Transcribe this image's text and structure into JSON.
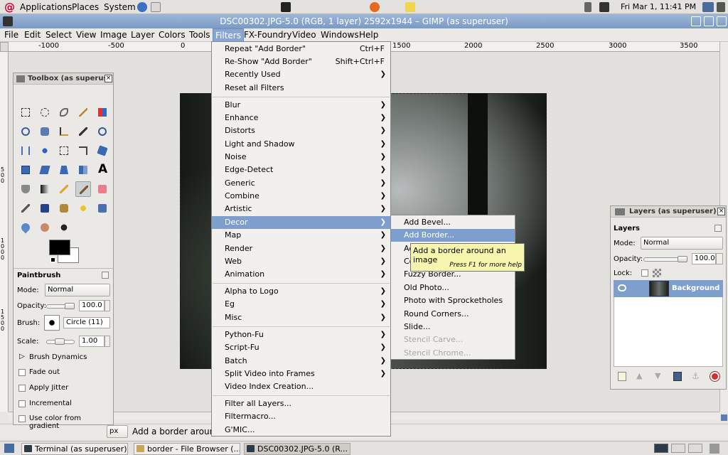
{
  "panel": {
    "menus": [
      "Applications",
      "Places",
      "System"
    ],
    "clock": "Fri Mar  1, 11:41 PM"
  },
  "window": {
    "title": "DSC00302.JPG-5.0 (RGB, 1 layer) 2592x1944 – GIMP (as superuser)"
  },
  "menubar": [
    "File",
    "Edit",
    "Select",
    "View",
    "Image",
    "Layer",
    "Colors",
    "Tools",
    "Filters",
    "FX-Foundry",
    "Video",
    "Windows",
    "Help"
  ],
  "ruler": [
    "-1000",
    "-500",
    "0",
    "1500",
    "2000",
    "2500",
    "3000",
    "3500"
  ],
  "ruler_left": [
    "5\n0\n0",
    "1\n0\n0\n0",
    "1\n5\n0\n0"
  ],
  "status": {
    "unit": "px",
    "text": "Add a border around a"
  },
  "taskbar": [
    "Terminal (as superuser)",
    "border - File Browser (...",
    "DSC00302.JPG-5.0 (R..."
  ],
  "toolbox": {
    "title": "Toolbox (as superus",
    "section": "Paintbrush",
    "mode_label": "Mode:",
    "mode_value": "Normal",
    "opacity_label": "Opacity:",
    "opacity_value": "100.0",
    "brush_label": "Brush:",
    "brush_value": "Circle (11)",
    "scale_label": "Scale:",
    "scale_value": "1.00",
    "dynamics": "Brush Dynamics",
    "options": [
      "Fade out",
      "Apply Jitter",
      "Incremental",
      "Use color from gradient"
    ]
  },
  "layers": {
    "title": "Layers (as superuser)",
    "heading": "Layers",
    "mode_label": "Mode:",
    "mode_value": "Normal",
    "opacity_label": "Opacity:",
    "opacity_value": "100.0",
    "lock_label": "Lock:",
    "layer_name": "Background"
  },
  "filters_menu": {
    "repeat": "Repeat \"Add Border\"",
    "repeat_acc": "Ctrl+F",
    "reshow": "Re-Show \"Add Border\"",
    "reshow_acc": "Shift+Ctrl+F",
    "recent": "Recently Used",
    "reset": "Reset all Filters",
    "group1": [
      "Blur",
      "Enhance",
      "Distorts",
      "Light and Shadow",
      "Noise",
      "Edge-Detect",
      "Generic",
      "Combine",
      "Artistic",
      "Decor",
      "Map",
      "Render",
      "Web",
      "Animation"
    ],
    "group2": [
      "Alpha to Logo",
      "Eg",
      "Misc"
    ],
    "group3": [
      "Python-Fu",
      "Script-Fu",
      "Batch",
      "Split Video into Frames",
      "Video Index Creation..."
    ],
    "group4": [
      "Filter all Layers...",
      "Filtermacro...",
      "G'MIC..."
    ]
  },
  "decor_menu": [
    "Add Bevel...",
    "Add Border...",
    "Ad",
    "Co",
    "Fuzzy Border...",
    "Old Photo...",
    "Photo with Sprocketholes",
    "Round Corners...",
    "Slide...",
    "Stencil Carve...",
    "Stencil Chrome..."
  ],
  "tooltip": {
    "text": "Add a border around an image",
    "hint": "Press F1 for more help"
  },
  "colors": {
    "selection": "#7e9fce",
    "title_bar": "#8aa7cf",
    "tooltip_bg": "#f8f6ae"
  }
}
